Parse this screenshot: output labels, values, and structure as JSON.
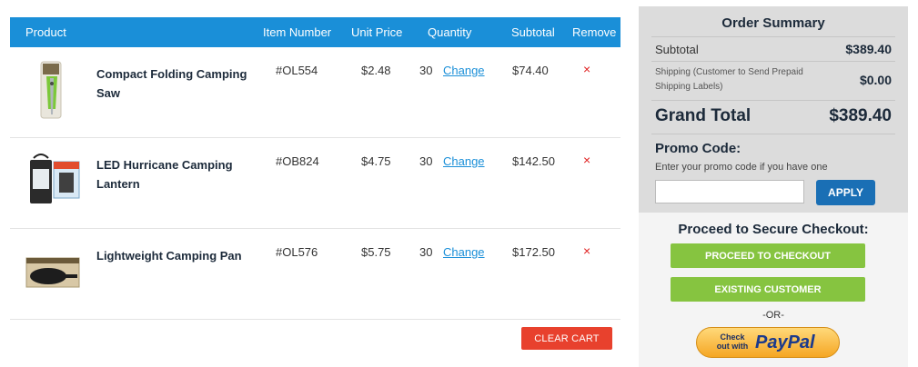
{
  "cart": {
    "headers": {
      "product": "Product",
      "item_number": "Item Number",
      "unit_price": "Unit Price",
      "quantity": "Quantity",
      "subtotal": "Subtotal",
      "remove": "Remove"
    },
    "rows": [
      {
        "name": "Compact Folding Camping Saw",
        "item": "#OL554",
        "price": "$2.48",
        "qty": "30",
        "change": "Change",
        "subtotal": "$74.40",
        "remove": "×",
        "thumb_icon": "folding-saw-icon"
      },
      {
        "name": "LED Hurricane Camping Lantern",
        "item": "#OB824",
        "price": "$4.75",
        "qty": "30",
        "change": "Change",
        "subtotal": "$142.50",
        "remove": "×",
        "thumb_icon": "lantern-icon"
      },
      {
        "name": "Lightweight Camping Pan",
        "item": "#OL576",
        "price": "$5.75",
        "qty": "30",
        "change": "Change",
        "subtotal": "$172.50",
        "remove": "×",
        "thumb_icon": "pan-icon"
      }
    ],
    "clear_label": "CLEAR CART"
  },
  "summary": {
    "title": "Order Summary",
    "subtotal_label": "Subtotal",
    "subtotal_value": "$389.40",
    "shipping_label": "Shipping (Customer to Send Prepaid Shipping Labels)",
    "shipping_value": "$0.00",
    "grand_label": "Grand Total",
    "grand_value": "$389.40",
    "promo_title": "Promo Code:",
    "promo_desc": "Enter your promo code if you have one",
    "promo_value": "",
    "apply_label": "APPLY"
  },
  "checkout": {
    "title": "Proceed to Secure Checkout:",
    "proceed_label": "PROCEED TO CHECKOUT",
    "existing_label": "EXISTING CUSTOMER",
    "or_text": "-OR-",
    "paypal_small": "Check out with",
    "paypal_logo": "PayPal"
  },
  "colors": {
    "header_blue": "#1a8fd8",
    "clear_red": "#e8412d",
    "checkout_green": "#86c440",
    "apply_blue": "#1a6fb5"
  }
}
